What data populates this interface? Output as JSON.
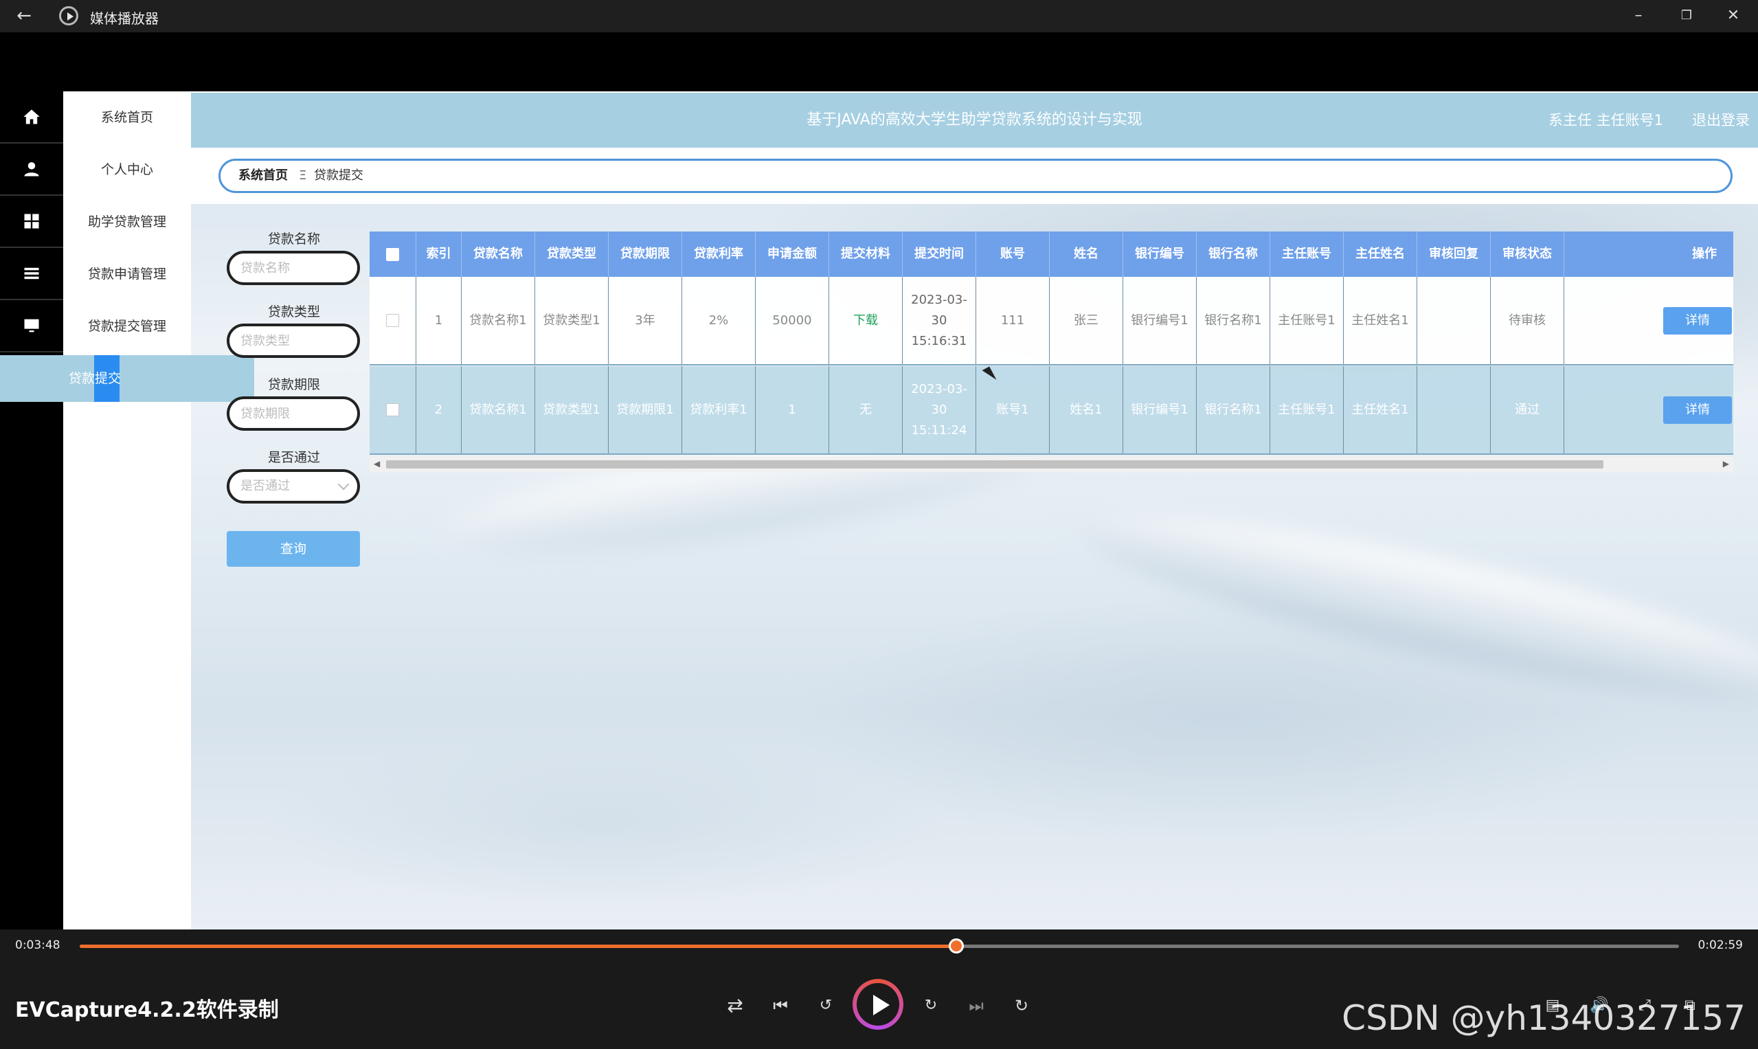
{
  "player": {
    "app_title": "媒体播放器",
    "time_current": "0:03:48",
    "time_remaining": "0:02:59",
    "progress_fraction": 0.548,
    "accent_color": "#f06f2b",
    "recorder_watermark": "EVCapture4.2.2软件录制",
    "csdn_watermark": "CSDN @yh1340327157",
    "icons": [
      "back-icon",
      "minimize-icon",
      "restore-icon",
      "close-icon",
      "shuffle-icon",
      "previous-icon",
      "rewind-10-icon",
      "play-icon",
      "forward-30-icon",
      "next-icon",
      "repeat-off-icon",
      "subtitles-icon",
      "volume-icon",
      "fullscreen-icon",
      "miniplayer-icon"
    ]
  },
  "header": {
    "title": "基于JAVA的高效大学生助学贷款系统的设计与实现",
    "user": "系主任 主任账号1",
    "logout": "退出登录",
    "bar_color": "#a6cfe2"
  },
  "sidebar": {
    "items": [
      {
        "label": "系统首页",
        "icon": "home-icon"
      },
      {
        "label": "个人中心",
        "icon": "user-icon"
      },
      {
        "label": "助学贷款管理",
        "icon": "grid-icon"
      },
      {
        "label": "贷款申请管理",
        "icon": "list-icon"
      },
      {
        "label": "贷款提交管理",
        "icon": "monitor-icon"
      }
    ],
    "active_sub": "贷款提交"
  },
  "breadcrumb": {
    "home": "系统首页",
    "separator": "Ξ",
    "current": "贷款提交"
  },
  "search": {
    "loan_name_label": "贷款名称",
    "loan_name_placeholder": "贷款名称",
    "loan_type_label": "贷款类型",
    "loan_type_placeholder": "贷款类型",
    "loan_term_label": "贷款期限",
    "loan_term_placeholder": "贷款期限",
    "passed_label": "是否通过",
    "passed_selected": "是否通过",
    "query_button": "查询"
  },
  "table": {
    "columns": [
      "索引",
      "贷款名称",
      "贷款类型",
      "贷款期限",
      "贷款利率",
      "申请金额",
      "提交材料",
      "提交时间",
      "账号",
      "姓名",
      "银行编号",
      "银行名称",
      "主任账号",
      "主任姓名",
      "审核回复",
      "审核状态",
      "操作"
    ],
    "rows": [
      {
        "index": "1",
        "loan_name": "贷款名称1",
        "loan_type": "贷款类型1",
        "term": "3年",
        "rate": "2%",
        "amount": "50000",
        "material": "下载",
        "time": "2023-03-30 15:16:31",
        "account": "111",
        "name": "张三",
        "bank_no": "银行编号1",
        "bank_name": "银行名称1",
        "director_account": "主任账号1",
        "director_name": "主任姓名1",
        "reply": "",
        "status": "待审核",
        "action": "详情"
      },
      {
        "index": "2",
        "loan_name": "贷款名称1",
        "loan_type": "贷款类型1",
        "term": "贷款期限1",
        "rate": "贷款利率1",
        "amount": "1",
        "material": "无",
        "time": "2023-03-30 15:11:24",
        "account": "账号1",
        "name": "姓名1",
        "bank_no": "银行编号1",
        "bank_name": "银行名称1",
        "director_account": "主任账号1",
        "director_name": "主任姓名1",
        "reply": "",
        "status": "通过",
        "action": "详情"
      }
    ]
  }
}
